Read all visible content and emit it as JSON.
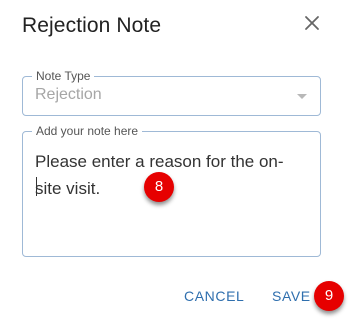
{
  "dialog": {
    "title": "Rejection Note"
  },
  "note_type": {
    "legend": "Note Type",
    "value": "Rejection"
  },
  "note": {
    "legend": "Add your note here",
    "value": "Please enter a reason for the on-site visit."
  },
  "annotations": {
    "step_8": "8",
    "step_9": "9"
  },
  "actions": {
    "cancel_label": "CANCEL",
    "save_label": "SAVE"
  },
  "colors": {
    "accent": "#2f6fae",
    "badge": "#e60000",
    "field_border": "#9fb9d6"
  },
  "icons": {
    "close": "close-icon",
    "dropdown": "chevron-down-icon"
  }
}
